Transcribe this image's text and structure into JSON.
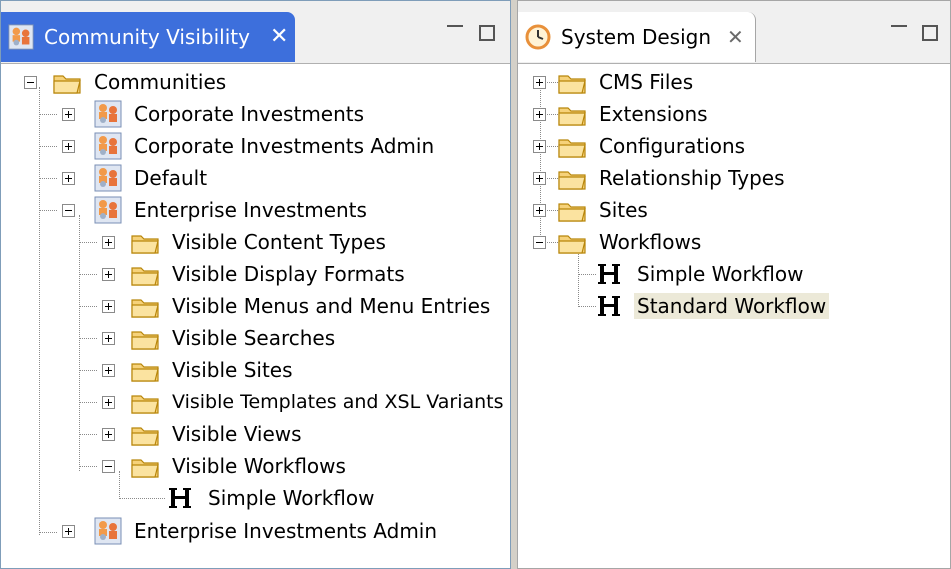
{
  "left_panel": {
    "tab_title": "Community Visibility",
    "tab_close": "✕",
    "tree": {
      "root": "Communities",
      "items": [
        "Corporate Investments",
        "Corporate Investments Admin",
        "Default",
        "Enterprise Investments",
        "Visible Content Types",
        "Visible Display Formats",
        "Visible Menus and Menu Entries",
        "Visible Searches",
        "Visible Sites",
        "Visible Templates and XSL Variants",
        "Visible Views",
        "Visible Workflows",
        "Simple Workflow",
        "Enterprise Investments Admin"
      ]
    }
  },
  "right_panel": {
    "tab_title": "System Design",
    "tab_close": "✕",
    "tree": {
      "items": [
        "CMS Files",
        "Extensions",
        "Configurations",
        "Relationship Types",
        "Sites",
        "Workflows",
        "Simple Workflow",
        "Standard Workflow"
      ]
    }
  },
  "colors": {
    "active_tab": "#3d6fdc",
    "selection": "#ece9d8",
    "folder": "#f2c14e"
  }
}
